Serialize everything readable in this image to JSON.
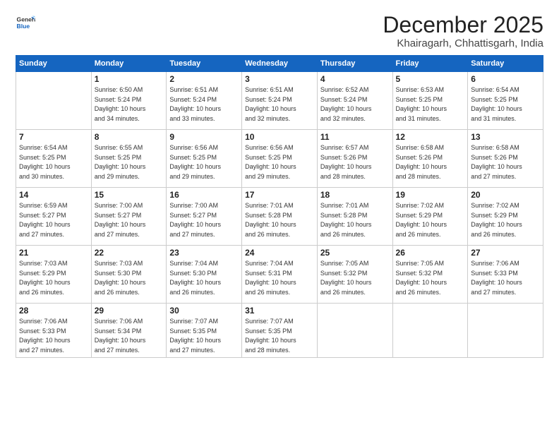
{
  "logo": {
    "general": "General",
    "blue": "Blue"
  },
  "header": {
    "month": "December 2025",
    "location": "Khairagarh, Chhattisgarh, India"
  },
  "weekdays": [
    "Sunday",
    "Monday",
    "Tuesday",
    "Wednesday",
    "Thursday",
    "Friday",
    "Saturday"
  ],
  "weeks": [
    [
      {
        "day": "",
        "info": ""
      },
      {
        "day": "1",
        "info": "Sunrise: 6:50 AM\nSunset: 5:24 PM\nDaylight: 10 hours\nand 34 minutes."
      },
      {
        "day": "2",
        "info": "Sunrise: 6:51 AM\nSunset: 5:24 PM\nDaylight: 10 hours\nand 33 minutes."
      },
      {
        "day": "3",
        "info": "Sunrise: 6:51 AM\nSunset: 5:24 PM\nDaylight: 10 hours\nand 32 minutes."
      },
      {
        "day": "4",
        "info": "Sunrise: 6:52 AM\nSunset: 5:24 PM\nDaylight: 10 hours\nand 32 minutes."
      },
      {
        "day": "5",
        "info": "Sunrise: 6:53 AM\nSunset: 5:25 PM\nDaylight: 10 hours\nand 31 minutes."
      },
      {
        "day": "6",
        "info": "Sunrise: 6:54 AM\nSunset: 5:25 PM\nDaylight: 10 hours\nand 31 minutes."
      }
    ],
    [
      {
        "day": "7",
        "info": "Sunrise: 6:54 AM\nSunset: 5:25 PM\nDaylight: 10 hours\nand 30 minutes."
      },
      {
        "day": "8",
        "info": "Sunrise: 6:55 AM\nSunset: 5:25 PM\nDaylight: 10 hours\nand 29 minutes."
      },
      {
        "day": "9",
        "info": "Sunrise: 6:56 AM\nSunset: 5:25 PM\nDaylight: 10 hours\nand 29 minutes."
      },
      {
        "day": "10",
        "info": "Sunrise: 6:56 AM\nSunset: 5:25 PM\nDaylight: 10 hours\nand 29 minutes."
      },
      {
        "day": "11",
        "info": "Sunrise: 6:57 AM\nSunset: 5:26 PM\nDaylight: 10 hours\nand 28 minutes."
      },
      {
        "day": "12",
        "info": "Sunrise: 6:58 AM\nSunset: 5:26 PM\nDaylight: 10 hours\nand 28 minutes."
      },
      {
        "day": "13",
        "info": "Sunrise: 6:58 AM\nSunset: 5:26 PM\nDaylight: 10 hours\nand 27 minutes."
      }
    ],
    [
      {
        "day": "14",
        "info": "Sunrise: 6:59 AM\nSunset: 5:27 PM\nDaylight: 10 hours\nand 27 minutes."
      },
      {
        "day": "15",
        "info": "Sunrise: 7:00 AM\nSunset: 5:27 PM\nDaylight: 10 hours\nand 27 minutes."
      },
      {
        "day": "16",
        "info": "Sunrise: 7:00 AM\nSunset: 5:27 PM\nDaylight: 10 hours\nand 27 minutes."
      },
      {
        "day": "17",
        "info": "Sunrise: 7:01 AM\nSunset: 5:28 PM\nDaylight: 10 hours\nand 26 minutes."
      },
      {
        "day": "18",
        "info": "Sunrise: 7:01 AM\nSunset: 5:28 PM\nDaylight: 10 hours\nand 26 minutes."
      },
      {
        "day": "19",
        "info": "Sunrise: 7:02 AM\nSunset: 5:29 PM\nDaylight: 10 hours\nand 26 minutes."
      },
      {
        "day": "20",
        "info": "Sunrise: 7:02 AM\nSunset: 5:29 PM\nDaylight: 10 hours\nand 26 minutes."
      }
    ],
    [
      {
        "day": "21",
        "info": "Sunrise: 7:03 AM\nSunset: 5:29 PM\nDaylight: 10 hours\nand 26 minutes."
      },
      {
        "day": "22",
        "info": "Sunrise: 7:03 AM\nSunset: 5:30 PM\nDaylight: 10 hours\nand 26 minutes."
      },
      {
        "day": "23",
        "info": "Sunrise: 7:04 AM\nSunset: 5:30 PM\nDaylight: 10 hours\nand 26 minutes."
      },
      {
        "day": "24",
        "info": "Sunrise: 7:04 AM\nSunset: 5:31 PM\nDaylight: 10 hours\nand 26 minutes."
      },
      {
        "day": "25",
        "info": "Sunrise: 7:05 AM\nSunset: 5:32 PM\nDaylight: 10 hours\nand 26 minutes."
      },
      {
        "day": "26",
        "info": "Sunrise: 7:05 AM\nSunset: 5:32 PM\nDaylight: 10 hours\nand 26 minutes."
      },
      {
        "day": "27",
        "info": "Sunrise: 7:06 AM\nSunset: 5:33 PM\nDaylight: 10 hours\nand 27 minutes."
      }
    ],
    [
      {
        "day": "28",
        "info": "Sunrise: 7:06 AM\nSunset: 5:33 PM\nDaylight: 10 hours\nand 27 minutes."
      },
      {
        "day": "29",
        "info": "Sunrise: 7:06 AM\nSunset: 5:34 PM\nDaylight: 10 hours\nand 27 minutes."
      },
      {
        "day": "30",
        "info": "Sunrise: 7:07 AM\nSunset: 5:35 PM\nDaylight: 10 hours\nand 27 minutes."
      },
      {
        "day": "31",
        "info": "Sunrise: 7:07 AM\nSunset: 5:35 PM\nDaylight: 10 hours\nand 28 minutes."
      },
      {
        "day": "",
        "info": ""
      },
      {
        "day": "",
        "info": ""
      },
      {
        "day": "",
        "info": ""
      }
    ]
  ]
}
